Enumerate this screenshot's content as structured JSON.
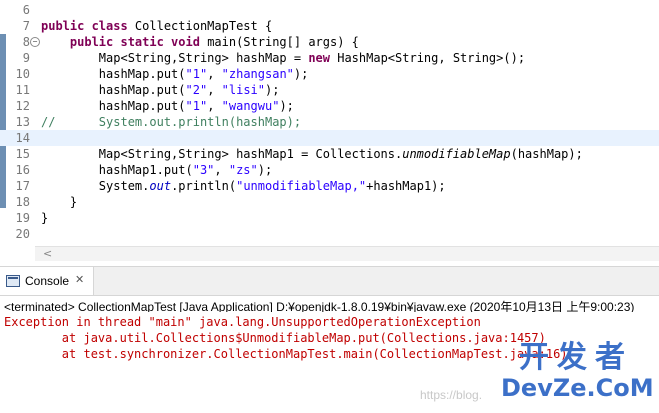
{
  "editor": {
    "lines": [
      {
        "num": "6",
        "parts": []
      },
      {
        "num": "7",
        "parts": [
          [
            "kw",
            "public class "
          ],
          [
            "",
            "CollectionMapTest {"
          ]
        ]
      },
      {
        "num": "8",
        "parts": [
          [
            "",
            "    "
          ],
          [
            "kw",
            "public static void "
          ],
          [
            "",
            "main(String[] args) {"
          ]
        ]
      },
      {
        "num": "9",
        "parts": [
          [
            "",
            "        Map<String,String> hashMap = "
          ],
          [
            "kw",
            "new "
          ],
          [
            "",
            "HashMap<String, String>();"
          ]
        ]
      },
      {
        "num": "10",
        "parts": [
          [
            "",
            "        hashMap.put("
          ],
          [
            "str",
            "\"1\""
          ],
          [
            "",
            ", "
          ],
          [
            "str",
            "\"zhangsan\""
          ],
          [
            "",
            ");"
          ]
        ]
      },
      {
        "num": "11",
        "parts": [
          [
            "",
            "        hashMap.put("
          ],
          [
            "str",
            "\"2\""
          ],
          [
            "",
            ", "
          ],
          [
            "str",
            "\"lisi\""
          ],
          [
            "",
            ");"
          ]
        ]
      },
      {
        "num": "12",
        "parts": [
          [
            "",
            "        hashMap.put("
          ],
          [
            "str",
            "\"1\""
          ],
          [
            "",
            ", "
          ],
          [
            "str",
            "\"wangwu\""
          ],
          [
            "",
            ");"
          ]
        ]
      },
      {
        "num": "13",
        "parts": [
          [
            "cmt",
            "//      System.out.println(hashMap);"
          ]
        ]
      },
      {
        "num": "14",
        "parts": []
      },
      {
        "num": "15",
        "parts": [
          [
            "",
            "        Map<String,String> hashMap1 = Collections."
          ],
          [
            "ital",
            "unmodifiableMap"
          ],
          [
            "",
            "(hashMap);"
          ]
        ]
      },
      {
        "num": "16",
        "parts": [
          [
            "",
            "        hashMap1.put("
          ],
          [
            "str",
            "\"3\""
          ],
          [
            "",
            ", "
          ],
          [
            "str",
            "\"zs\""
          ],
          [
            "",
            ");"
          ]
        ]
      },
      {
        "num": "17",
        "parts": [
          [
            "",
            "        System."
          ],
          [
            "field",
            "out"
          ],
          [
            "",
            ".println("
          ],
          [
            "str",
            "\"unmodifiableMap,\""
          ],
          [
            "",
            "+hashMap1);"
          ]
        ]
      },
      {
        "num": "18",
        "parts": [
          [
            "",
            "    }"
          ]
        ]
      },
      {
        "num": "19",
        "parts": [
          [
            "",
            "}"
          ]
        ]
      },
      {
        "num": "20",
        "parts": []
      }
    ],
    "current_line": "14"
  },
  "console": {
    "tab_label": "Console",
    "close_glyph": "✕",
    "status": "<terminated> CollectionMapTest [Java Application] D:¥openjdk-1.8.0.19¥bin¥javaw.exe (2020年10月13日 上午9:00:23)",
    "output": [
      "Exception in thread \"main\" java.lang.UnsupportedOperationException",
      "        at java.util.Collections$UnmodifiableMap.put(Collections.java:1457)",
      "        at test.synchronizer.CollectionMapTest.main(CollectionMapTest.java:16)"
    ]
  },
  "watermark": {
    "top": "开发者",
    "bottom": "DevZe.CoM",
    "url": "https://blog."
  },
  "colors": {
    "keyword": "#7f0055",
    "string": "#2a00ff",
    "comment": "#3f7f5f",
    "error": "#c00000"
  }
}
